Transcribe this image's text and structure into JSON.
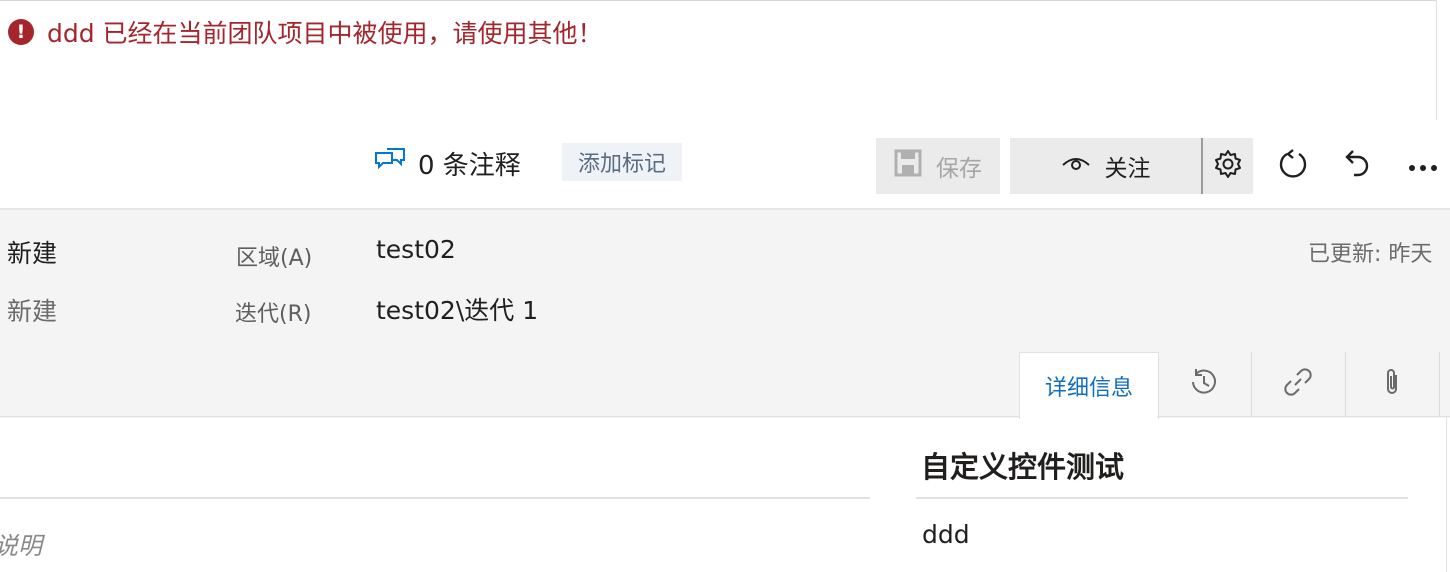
{
  "error": {
    "message": "ddd 已经在当前团队项目中被使用，请使用其他！",
    "icon": "error-circle-icon",
    "color": "#a4262c"
  },
  "toolbar": {
    "comments_count": "0 条注释",
    "add_tag_label": "添加标记",
    "save_label": "保存",
    "follow_label": "关注"
  },
  "header": {
    "state": "新建",
    "reason": "新建",
    "area_label": "区域(A)",
    "area_value": "test02",
    "iteration_label": "迭代(R)",
    "iteration_value": "test02\\迭代 1",
    "updated": "已更新: 昨天"
  },
  "tabs": {
    "details_label": "详细信息"
  },
  "main": {
    "description_label": "说明"
  },
  "custom_section": {
    "title": "自定义控件测试",
    "value": "ddd"
  },
  "colors": {
    "accent": "#106ebe",
    "error": "#a4262c",
    "button_bg": "#ebebeb",
    "header_bg": "#f4f4f4"
  }
}
